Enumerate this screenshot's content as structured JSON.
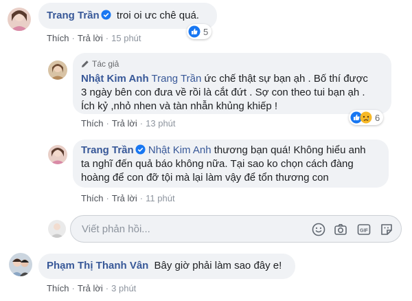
{
  "comments": [
    {
      "author": "Trang Trần",
      "verified": true,
      "text": "troi oi ưc chê quá.",
      "actions": {
        "like": "Thích",
        "reply": "Trả lời",
        "time": "15 phút"
      },
      "reaction_count": "5"
    },
    {
      "badge": "Tác giả",
      "author": "Nhật Kim Anh",
      "tagged": "Trang Trần",
      "text_line1": " ức chế thật sự bạn ạh . Bố thí được",
      "text_line2": "3 ngày bên con đưa về rồi là cắt đứt . Sợ con theo tui bạn ạh .",
      "text_line3": "Ích kỷ ,nhỏ nhen và tàn nhẫn khủng khiếp !",
      "actions": {
        "like": "Thích",
        "reply": "Trả lời",
        "time": "13 phút"
      },
      "reaction_count": "6"
    },
    {
      "author": "Trang Trần",
      "verified": true,
      "tagged": "Nhật Kim Anh",
      "text_line1": " thương bạn quá! Không hiểu anh",
      "text_line2": "ta nghĩ đến quả báo không nữa. Tại sao ko chọn cách đàng",
      "text_line3": "hoàng để con đỡ tội mà lại làm vậy để tổn thương con",
      "actions": {
        "like": "Thích",
        "reply": "Trả lời",
        "time": "11 phút"
      }
    },
    {
      "author": "Phạm Thị Thanh Vân",
      "text": "Bây giờ phải làm sao đây e!",
      "actions": {
        "like": "Thích",
        "reply": "Trả lời",
        "time": "3 phút"
      }
    }
  ],
  "reply_box": {
    "placeholder": "Viết phản hồi...",
    "gif_label": "GIF"
  },
  "colors": {
    "name": "#385898",
    "bubble": "#f0f2f5",
    "like": "#1877f2",
    "sad": "#f7b928"
  },
  "icons": [
    "verified-icon",
    "like-icon",
    "sad-icon",
    "pencil-icon",
    "emoji-icon",
    "camera-icon",
    "gif-icon",
    "sticker-icon"
  ]
}
